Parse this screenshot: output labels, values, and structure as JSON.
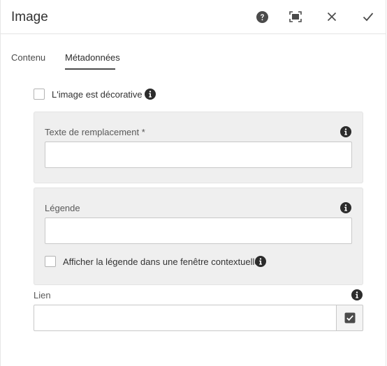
{
  "dialog": {
    "title": "Image",
    "actions": {
      "help_icon": "help-icon",
      "fullscreen_icon": "fullscreen-icon",
      "close_icon": "close-icon",
      "done_icon": "checkmark-icon"
    }
  },
  "tabs": [
    {
      "label": "Contenu",
      "active": false
    },
    {
      "label": "Métadonnées",
      "active": true
    }
  ],
  "form": {
    "decorative": {
      "label": "L'image est décorative",
      "checked": false
    },
    "alt_text": {
      "label": "Texte de remplacement *",
      "value": "",
      "placeholder": ""
    },
    "caption": {
      "label": "Légende",
      "value": "",
      "placeholder": ""
    },
    "caption_popup": {
      "label": "Afficher la légende dans une fenêtre contextuelle",
      "checked": false
    },
    "link": {
      "label": "Lien",
      "value": "",
      "placeholder": ""
    }
  },
  "colors": {
    "accent": "#323232",
    "panel_bg": "#efefef",
    "border": "#c8c8c8"
  }
}
